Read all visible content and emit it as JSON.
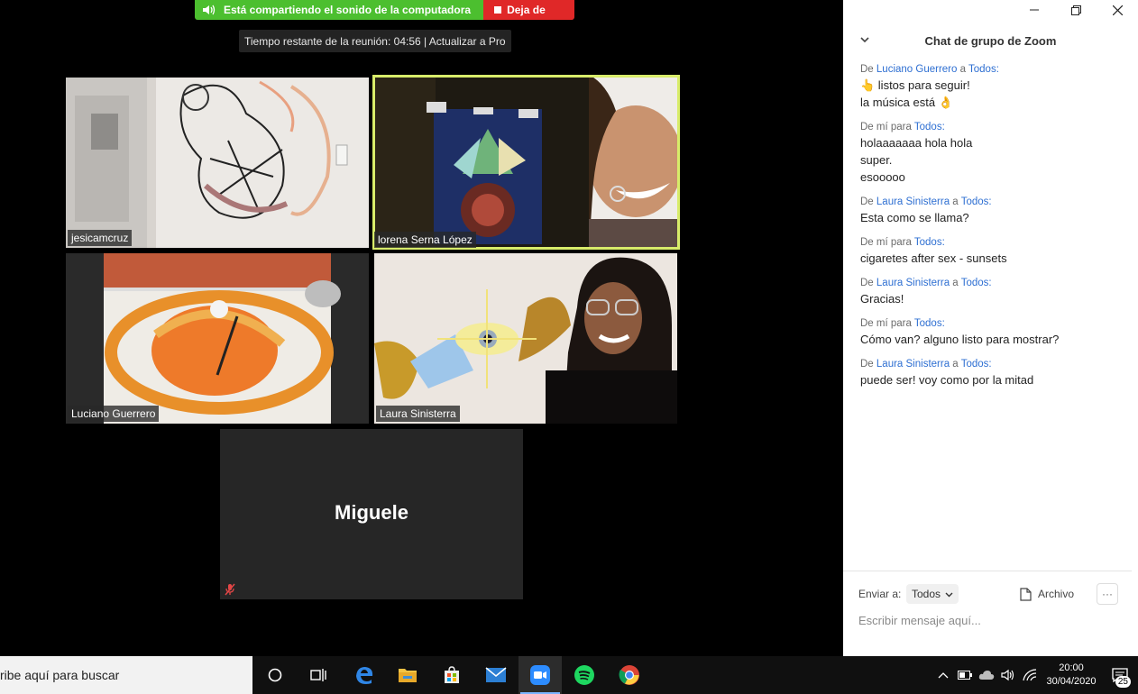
{
  "share_bar": {
    "message": "Está compartiendo el sonido de la computadora",
    "stop_label": "Deja de"
  },
  "timer": {
    "text": "Tiempo restante de la reunión: 04:56 | Actualizar a Pro"
  },
  "participants": [
    {
      "name": "jesicamcruz",
      "active": false
    },
    {
      "name": "lorena Serna López",
      "active": true
    },
    {
      "name": "Luciano Guerrero",
      "active": false
    },
    {
      "name": "Laura Sinisterra",
      "active": false
    },
    {
      "name": "Miguele",
      "active": false,
      "video_off": true,
      "muted": true
    }
  ],
  "chat": {
    "title": "Chat de grupo de Zoom",
    "messages": [
      {
        "prefix": "De",
        "from": "Luciano Guerrero",
        "conn": "a",
        "to": "Todos:",
        "lines": [
          "👆 listos para seguir!",
          "la música está 👌"
        ]
      },
      {
        "prefix": "De mí para",
        "from": "",
        "conn": "",
        "to": "Todos:",
        "lines": [
          "holaaaaaaa hola hola",
          "super.",
          "esooooo"
        ]
      },
      {
        "prefix": "De",
        "from": "Laura Sinisterra",
        "conn": "a",
        "to": "Todos:",
        "lines": [
          "Esta como se llama?"
        ]
      },
      {
        "prefix": "De mí para",
        "from": "",
        "conn": "",
        "to": "Todos:",
        "lines": [
          "cigaretes after sex - sunsets"
        ]
      },
      {
        "prefix": "De",
        "from": "Laura Sinisterra",
        "conn": "a",
        "to": "Todos:",
        "lines": [
          "Gracias!"
        ]
      },
      {
        "prefix": "De mí para",
        "from": "",
        "conn": "",
        "to": "Todos:",
        "lines": [
          "Cómo van? alguno listo para mostrar?"
        ]
      },
      {
        "prefix": "De",
        "from": "Laura Sinisterra",
        "conn": "a",
        "to": "Todos:",
        "lines": [
          "puede ser! voy como por la mitad"
        ]
      }
    ],
    "footer": {
      "send_to_label": "Enviar a:",
      "send_to_value": "Todos",
      "file_label": "Archivo",
      "more_label": "···",
      "input_placeholder": "Escribir mensaje aquí..."
    }
  },
  "taskbar": {
    "search_placeholder": "ribe aquí para buscar",
    "time": "20:00",
    "date": "30/04/2020",
    "notifications": "25"
  },
  "colors": {
    "chat_link": "#2e6fd2",
    "share_green": "#4cbf2f",
    "stop_red": "#e02828",
    "active_speaker": "#d8ec6a"
  }
}
